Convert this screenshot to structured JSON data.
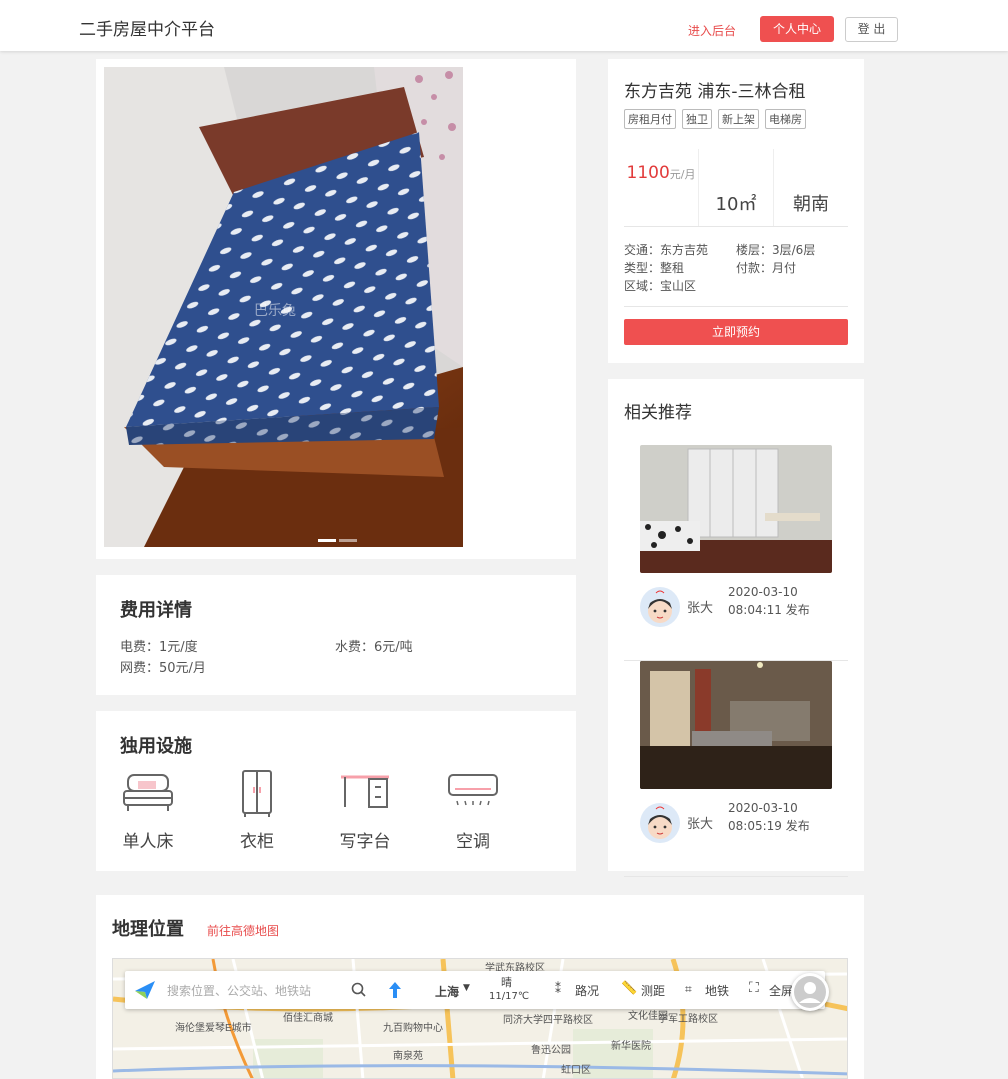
{
  "header": {
    "brand": "二手房屋中介平台",
    "admin_link": "进入后台",
    "user_center": "个人中心",
    "logout": "登 出"
  },
  "listing": {
    "title": "东方吉苑 浦东-三林合租",
    "tags": [
      "房租月付",
      "独卫",
      "新上架",
      "电梯房"
    ],
    "price": "1100",
    "price_unit": "元/月",
    "area": "10㎡",
    "orientation": "朝南",
    "details": {
      "traffic": "交通：东方吉苑",
      "floor": "楼层：3层/6层",
      "type": "类型：整租",
      "payment": "付款：月付",
      "district": "区域：宝山区"
    },
    "book_button": "立即预约"
  },
  "recommend": {
    "title": "相关推荐",
    "items": [
      {
        "name": "张大",
        "date": "2020-03-10",
        "time": "08:04:11 发布"
      },
      {
        "name": "张大",
        "date": "2020-03-10",
        "time": "08:05:19 发布"
      }
    ]
  },
  "fees": {
    "title": "费用详情",
    "electric": "电费：1元/度",
    "water": "水费：6元/吨",
    "internet": "网费：50元/月"
  },
  "amenities": {
    "title": "独用设施",
    "items": [
      {
        "label": "单人床",
        "icon": "bed-icon"
      },
      {
        "label": "衣柜",
        "icon": "wardrobe-icon"
      },
      {
        "label": "写字台",
        "icon": "desk-icon"
      },
      {
        "label": "空调",
        "icon": "air-conditioner-icon"
      }
    ]
  },
  "location": {
    "title": "地理位置",
    "map_link": "前往高德地图",
    "search_placeholder": "搜索位置、公交站、地铁站",
    "city": "上海",
    "weather": "晴",
    "temperature": "11/17℃",
    "traffic": "路况",
    "measure": "测距",
    "subway": "地铁",
    "fullscreen": "全屏",
    "map_labels": [
      "学武东路校区",
      "海伦堡爱琴E城市",
      "佰佳汇商城",
      "九百购物中心",
      "同济大学四平路校区",
      "文化佳园",
      "学军工路校区",
      "南泉苑",
      "鲁迅公园",
      "新华医院",
      "虹口区"
    ]
  },
  "colors": {
    "accent": "#ef5050",
    "link": "#e84c4c"
  }
}
